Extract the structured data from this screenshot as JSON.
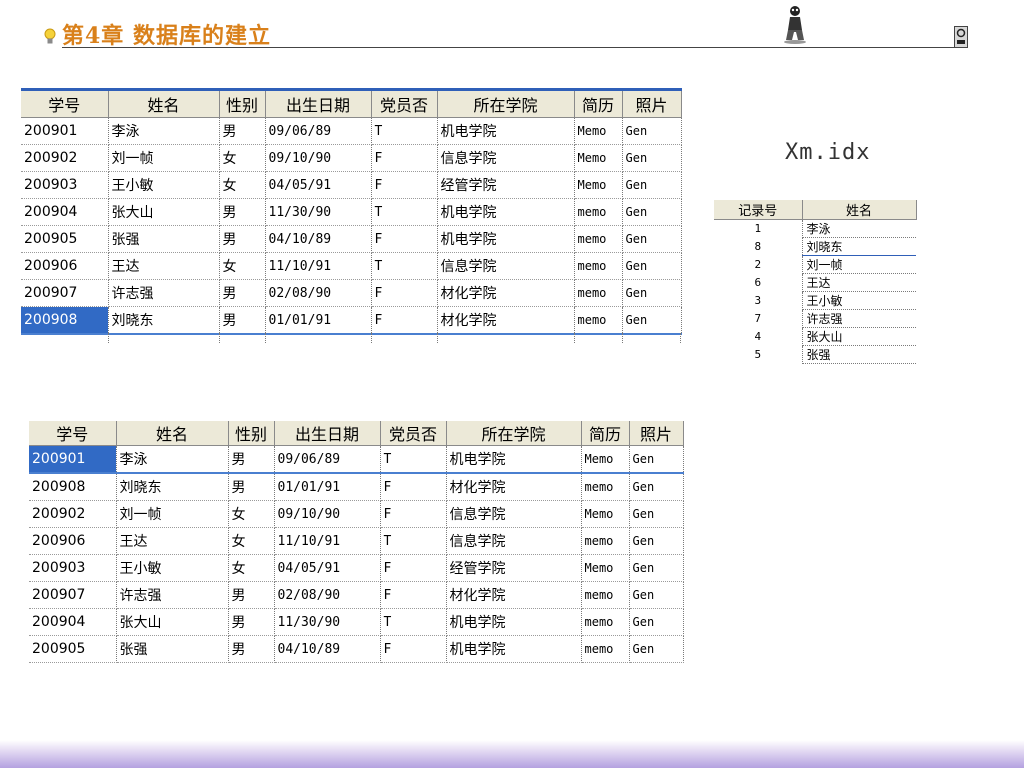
{
  "header": {
    "title": "第4章  数据库的建立"
  },
  "columns": [
    "学号",
    "姓名",
    "性别",
    "出生日期",
    "党员否",
    "所在学院",
    "简历",
    "照片"
  ],
  "table1": {
    "rows": [
      [
        "200901",
        "李泳",
        "男",
        "09/06/89",
        "T",
        "机电学院",
        "Memo",
        "Gen"
      ],
      [
        "200902",
        "刘一帧",
        "女",
        "09/10/90",
        "F",
        "信息学院",
        "Memo",
        "Gen"
      ],
      [
        "200903",
        "王小敏",
        "女",
        "04/05/91",
        "F",
        "经管学院",
        "Memo",
        "Gen"
      ],
      [
        "200904",
        "张大山",
        "男",
        "11/30/90",
        "T",
        "机电学院",
        "memo",
        "Gen"
      ],
      [
        "200905",
        "张强",
        "男",
        "04/10/89",
        "F",
        "机电学院",
        "memo",
        "Gen"
      ],
      [
        "200906",
        "王达",
        "女",
        "11/10/91",
        "T",
        "信息学院",
        "memo",
        "Gen"
      ],
      [
        "200907",
        "许志强",
        "男",
        "02/08/90",
        "F",
        "材化学院",
        "memo",
        "Gen"
      ],
      [
        "200908",
        "刘晓东",
        "男",
        "01/01/91",
        "F",
        "材化学院",
        "memo",
        "Gen"
      ]
    ]
  },
  "index_file": {
    "label": "Xm.idx",
    "columns": [
      "记录号",
      "姓名"
    ],
    "rows": [
      [
        "1",
        "李泳"
      ],
      [
        "8",
        "刘晓东"
      ],
      [
        "2",
        "刘一帧"
      ],
      [
        "6",
        "王达"
      ],
      [
        "3",
        "王小敏"
      ],
      [
        "7",
        "许志强"
      ],
      [
        "4",
        "张大山"
      ],
      [
        "5",
        "张强"
      ]
    ]
  },
  "table2": {
    "rows": [
      [
        "200901",
        "李泳",
        "男",
        "09/06/89",
        "T",
        "机电学院",
        "Memo",
        "Gen"
      ],
      [
        "200908",
        "刘晓东",
        "男",
        "01/01/91",
        "F",
        "材化学院",
        "memo",
        "Gen"
      ],
      [
        "200902",
        "刘一帧",
        "女",
        "09/10/90",
        "F",
        "信息学院",
        "Memo",
        "Gen"
      ],
      [
        "200906",
        "王达",
        "女",
        "11/10/91",
        "T",
        "信息学院",
        "memo",
        "Gen"
      ],
      [
        "200903",
        "王小敏",
        "女",
        "04/05/91",
        "F",
        "经管学院",
        "Memo",
        "Gen"
      ],
      [
        "200907",
        "许志强",
        "男",
        "02/08/90",
        "F",
        "材化学院",
        "memo",
        "Gen"
      ],
      [
        "200904",
        "张大山",
        "男",
        "11/30/90",
        "T",
        "机电学院",
        "memo",
        "Gen"
      ],
      [
        "200905",
        "张强",
        "男",
        "04/10/89",
        "F",
        "机电学院",
        "memo",
        "Gen"
      ]
    ]
  },
  "colors": {
    "title": "#d9801a",
    "selection": "#316ac5",
    "header_bg": "#ece9d8",
    "accent_line": "#2f5fb8"
  },
  "icons": {
    "bulb": "lightbulb-icon",
    "figure": "cartoon-figure-icon",
    "corner": "nav-corner-icon"
  }
}
